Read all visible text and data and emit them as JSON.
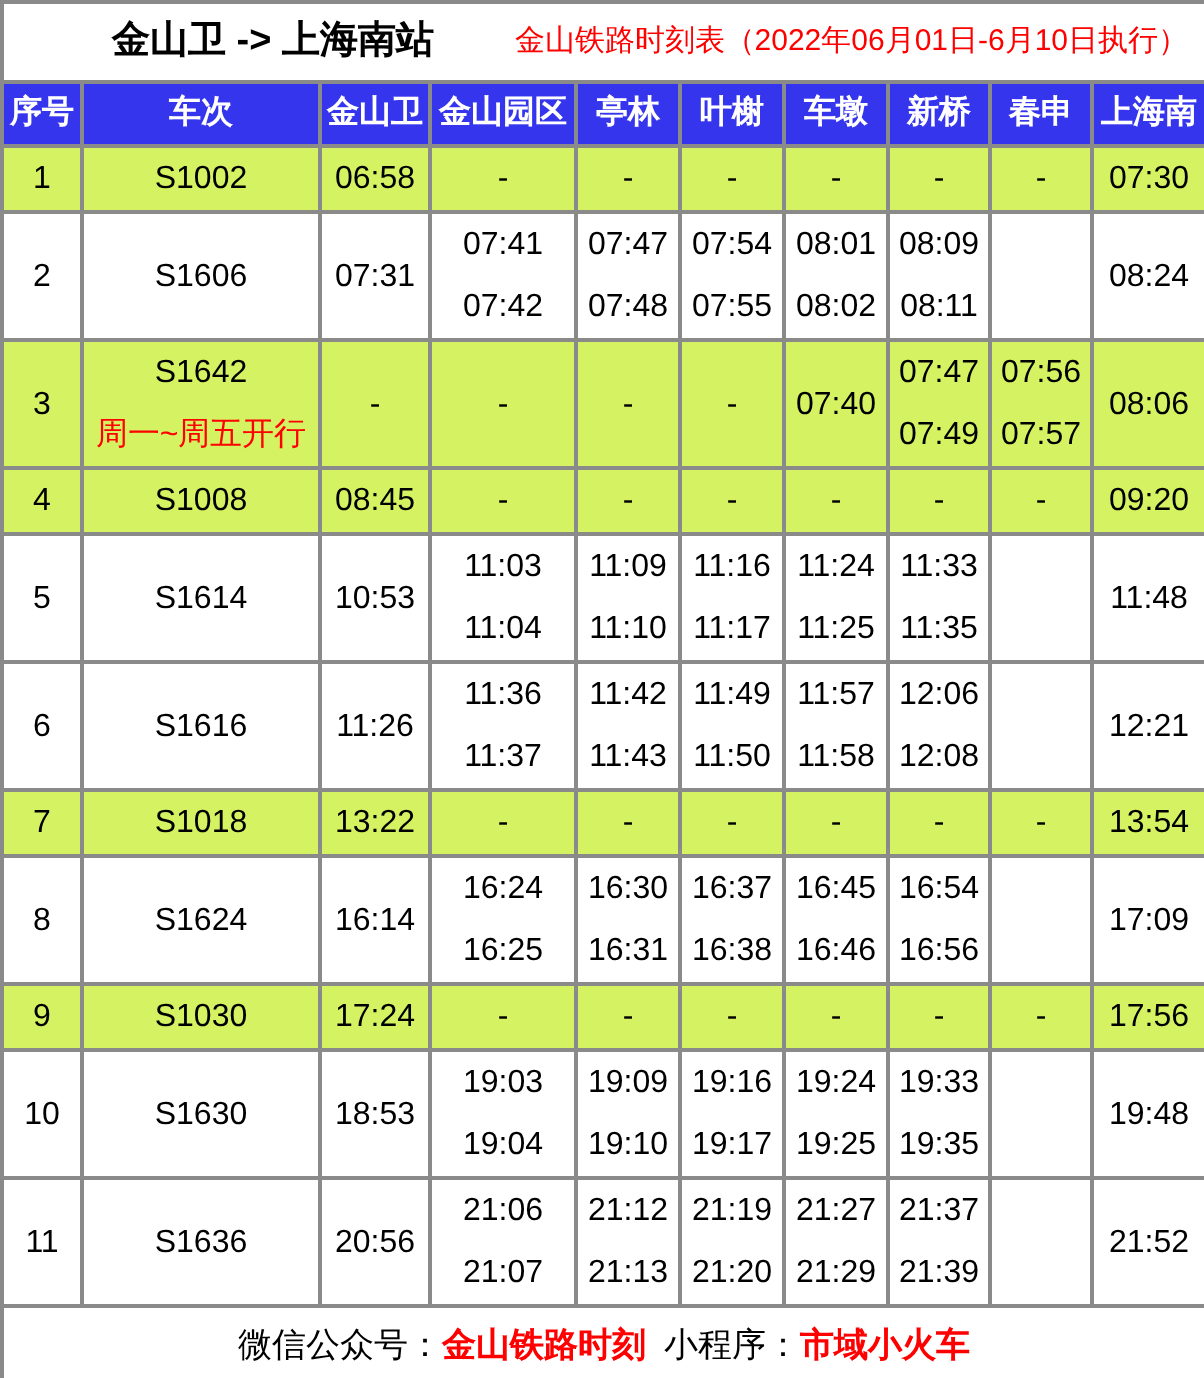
{
  "title": "金山卫 -> 上海南站",
  "subtitle": "金山铁路时刻表（2022年06月01日-6月10日执行）",
  "columns": [
    "序号",
    "车次",
    "金山卫",
    "金山园区",
    "亭林",
    "叶榭",
    "车墩",
    "新桥",
    "春申",
    "上海南"
  ],
  "rows": [
    {
      "index": "1",
      "train": "S1002",
      "highlighted": true,
      "cells": [
        {
          "times": [
            "06:58"
          ]
        },
        {
          "times": [
            "-"
          ]
        },
        {
          "times": [
            "-"
          ]
        },
        {
          "times": [
            "-"
          ]
        },
        {
          "times": [
            "-"
          ]
        },
        {
          "times": [
            "-"
          ]
        },
        {
          "times": [
            "-"
          ]
        },
        {
          "times": [
            "07:30"
          ]
        }
      ]
    },
    {
      "index": "2",
      "train": "S1606",
      "highlighted": false,
      "cells": [
        {
          "times": [
            "07:31"
          ]
        },
        {
          "times": [
            "07:41",
            "07:42"
          ]
        },
        {
          "times": [
            "07:47",
            "07:48"
          ]
        },
        {
          "times": [
            "07:54",
            "07:55"
          ]
        },
        {
          "times": [
            "08:01",
            "08:02"
          ]
        },
        {
          "times": [
            "08:09",
            "08:11"
          ]
        },
        {
          "empty": true
        },
        {
          "times": [
            "08:24"
          ]
        }
      ]
    },
    {
      "index": "3",
      "train": "S1642",
      "note": "周一~周五开行",
      "highlighted": true,
      "cells": [
        {
          "times": [
            "-"
          ]
        },
        {
          "times": [
            "-"
          ]
        },
        {
          "times": [
            "-"
          ]
        },
        {
          "times": [
            "-"
          ]
        },
        {
          "times": [
            "07:40"
          ]
        },
        {
          "times": [
            "07:47",
            "07:49"
          ]
        },
        {
          "times": [
            "07:56",
            "07:57"
          ]
        },
        {
          "times": [
            "08:06"
          ]
        }
      ]
    },
    {
      "index": "4",
      "train": "S1008",
      "highlighted": true,
      "cells": [
        {
          "times": [
            "08:45"
          ]
        },
        {
          "times": [
            "-"
          ]
        },
        {
          "times": [
            "-"
          ]
        },
        {
          "times": [
            "-"
          ]
        },
        {
          "times": [
            "-"
          ]
        },
        {
          "times": [
            "-"
          ]
        },
        {
          "times": [
            "-"
          ]
        },
        {
          "times": [
            "09:20"
          ]
        }
      ]
    },
    {
      "index": "5",
      "train": "S1614",
      "highlighted": false,
      "cells": [
        {
          "times": [
            "10:53"
          ]
        },
        {
          "times": [
            "11:03",
            "11:04"
          ]
        },
        {
          "times": [
            "11:09",
            "11:10"
          ]
        },
        {
          "times": [
            "11:16",
            "11:17"
          ]
        },
        {
          "times": [
            "11:24",
            "11:25"
          ]
        },
        {
          "times": [
            "11:33",
            "11:35"
          ]
        },
        {
          "empty": true
        },
        {
          "times": [
            "11:48"
          ]
        }
      ]
    },
    {
      "index": "6",
      "train": "S1616",
      "highlighted": false,
      "cells": [
        {
          "times": [
            "11:26"
          ]
        },
        {
          "times": [
            "11:36",
            "11:37"
          ]
        },
        {
          "times": [
            "11:42",
            "11:43"
          ]
        },
        {
          "times": [
            "11:49",
            "11:50"
          ]
        },
        {
          "times": [
            "11:57",
            "11:58"
          ]
        },
        {
          "times": [
            "12:06",
            "12:08"
          ]
        },
        {
          "empty": true
        },
        {
          "times": [
            "12:21"
          ]
        }
      ]
    },
    {
      "index": "7",
      "train": "S1018",
      "highlighted": true,
      "cells": [
        {
          "times": [
            "13:22"
          ]
        },
        {
          "times": [
            "-"
          ]
        },
        {
          "times": [
            "-"
          ]
        },
        {
          "times": [
            "-"
          ]
        },
        {
          "times": [
            "-"
          ]
        },
        {
          "times": [
            "-"
          ]
        },
        {
          "times": [
            "-"
          ]
        },
        {
          "times": [
            "13:54"
          ]
        }
      ]
    },
    {
      "index": "8",
      "train": "S1624",
      "highlighted": false,
      "cells": [
        {
          "times": [
            "16:14"
          ]
        },
        {
          "times": [
            "16:24",
            "16:25"
          ]
        },
        {
          "times": [
            "16:30",
            "16:31"
          ]
        },
        {
          "times": [
            "16:37",
            "16:38"
          ]
        },
        {
          "times": [
            "16:45",
            "16:46"
          ]
        },
        {
          "times": [
            "16:54",
            "16:56"
          ]
        },
        {
          "empty": true
        },
        {
          "times": [
            "17:09"
          ]
        }
      ]
    },
    {
      "index": "9",
      "train": "S1030",
      "highlighted": true,
      "cells": [
        {
          "times": [
            "17:24"
          ]
        },
        {
          "times": [
            "-"
          ]
        },
        {
          "times": [
            "-"
          ]
        },
        {
          "times": [
            "-"
          ]
        },
        {
          "times": [
            "-"
          ]
        },
        {
          "times": [
            "-"
          ]
        },
        {
          "times": [
            "-"
          ]
        },
        {
          "times": [
            "17:56"
          ]
        }
      ]
    },
    {
      "index": "10",
      "train": "S1630",
      "highlighted": false,
      "cells": [
        {
          "times": [
            "18:53"
          ]
        },
        {
          "times": [
            "19:03",
            "19:04"
          ]
        },
        {
          "times": [
            "19:09",
            "19:10"
          ]
        },
        {
          "times": [
            "19:16",
            "19:17"
          ]
        },
        {
          "times": [
            "19:24",
            "19:25"
          ]
        },
        {
          "times": [
            "19:33",
            "19:35"
          ]
        },
        {
          "empty": true
        },
        {
          "times": [
            "19:48"
          ]
        }
      ]
    },
    {
      "index": "11",
      "train": "S1636",
      "highlighted": false,
      "cells": [
        {
          "times": [
            "20:56"
          ]
        },
        {
          "times": [
            "21:06",
            "21:07"
          ]
        },
        {
          "times": [
            "21:12",
            "21:13"
          ]
        },
        {
          "times": [
            "21:19",
            "21:20"
          ]
        },
        {
          "times": [
            "21:27",
            "21:29"
          ]
        },
        {
          "times": [
            "21:37",
            "21:39"
          ]
        },
        {
          "empty": true
        },
        {
          "times": [
            "21:52"
          ]
        }
      ]
    }
  ],
  "footer": "微信公众号：**金山铁路时刻**  小程序：**市域小火车**"
}
